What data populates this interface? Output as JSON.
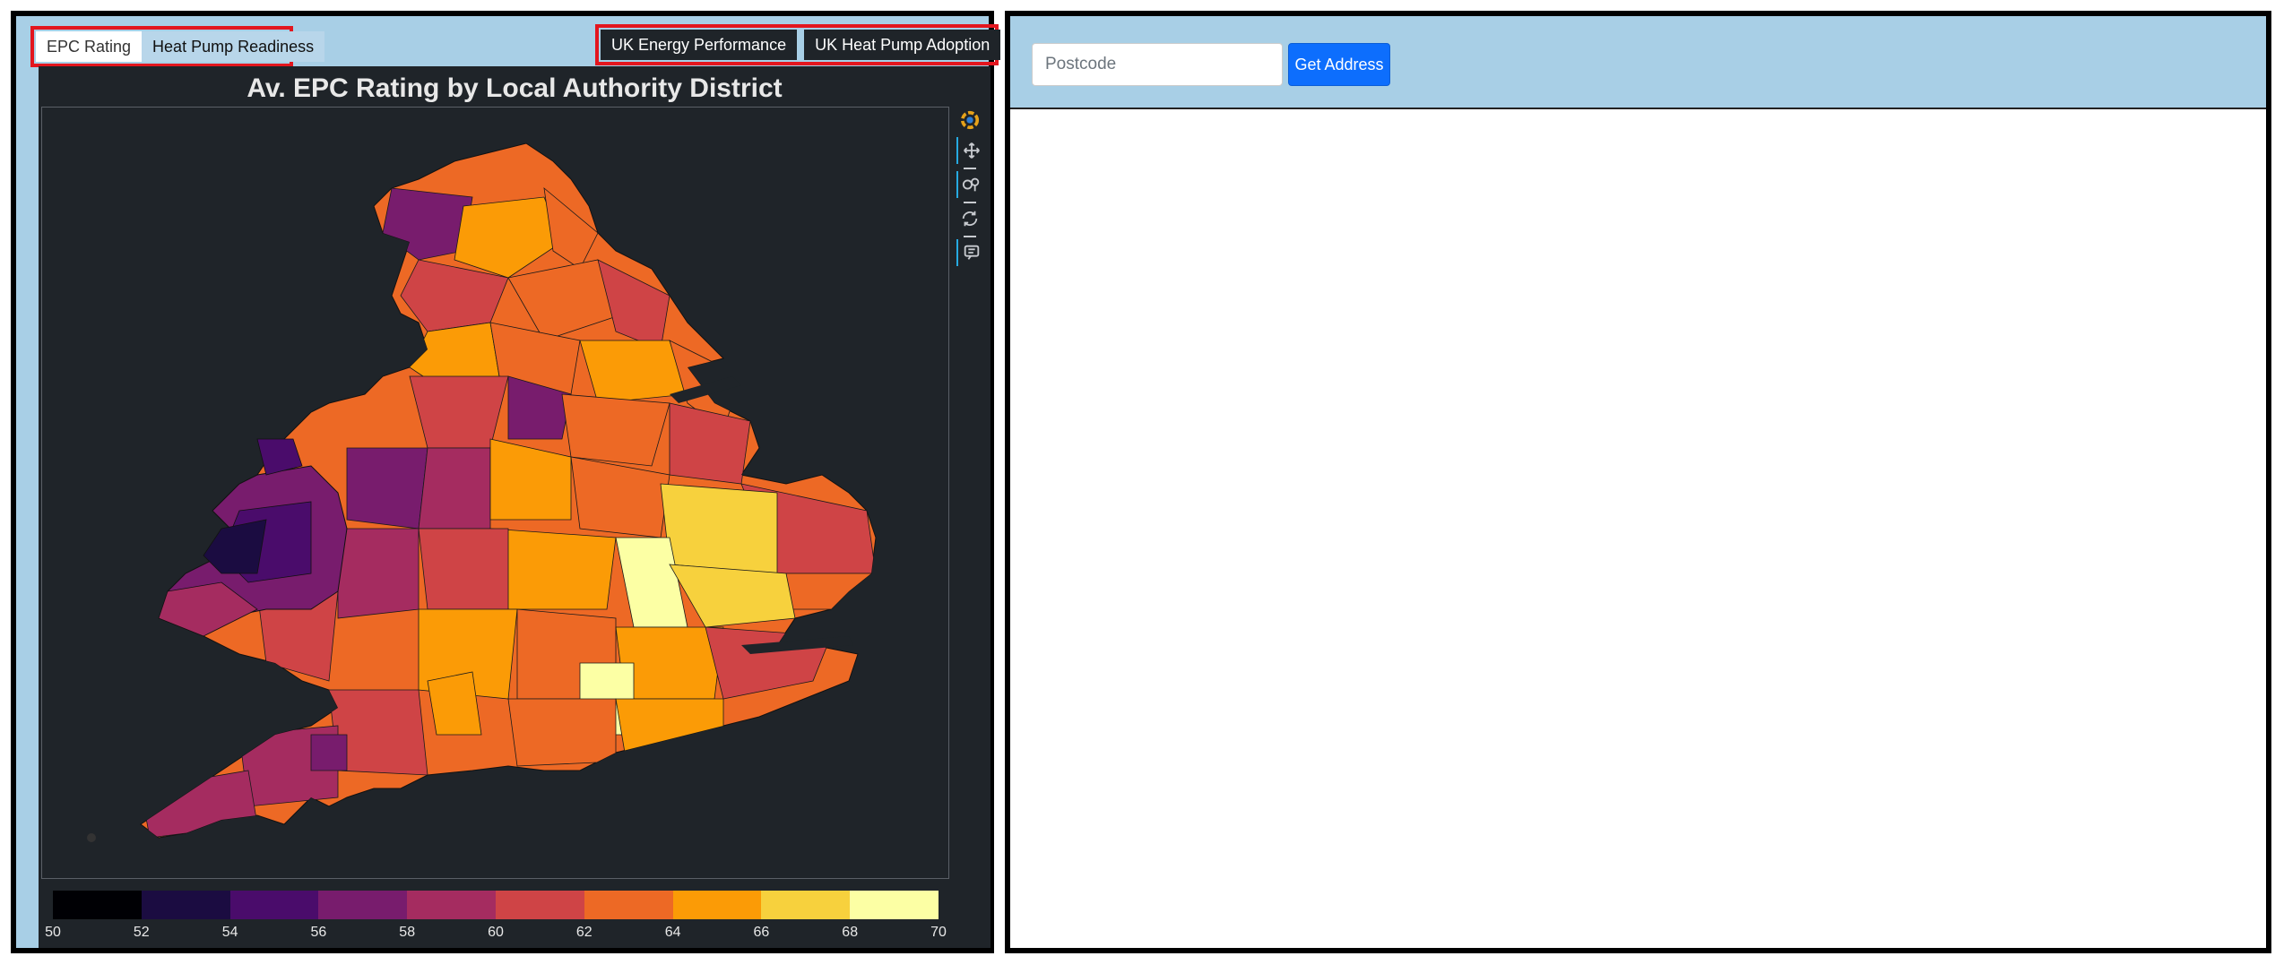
{
  "left_tabs": [
    {
      "label": "EPC Rating",
      "active": true
    },
    {
      "label": "Heat Pump Readiness",
      "active": false
    }
  ],
  "right_tabs": [
    {
      "label": "UK Energy Performance"
    },
    {
      "label": "UK Heat Pump Adoption"
    }
  ],
  "chart": {
    "title": "Av. EPC Rating by Local Authority District",
    "colorbar": {
      "colors": [
        "#000004",
        "#1b0c41",
        "#4a0c6b",
        "#781c6d",
        "#a52c60",
        "#cf4446",
        "#ed6925",
        "#fb9b06",
        "#f7d13d",
        "#fcffa4"
      ],
      "ticks": [
        "50",
        "52",
        "54",
        "56",
        "58",
        "60",
        "62",
        "64",
        "66",
        "68",
        "70"
      ],
      "min": 50,
      "max": 70
    },
    "toolbar_icons": [
      "bokeh-logo-icon",
      "pan-icon",
      "wheel-zoom-icon",
      "reset-icon",
      "hover-icon"
    ]
  },
  "chart_data": {
    "type": "heatmap",
    "title": "Av. EPC Rating by Local Authority District",
    "colorbar_range": [
      50,
      70
    ],
    "colorbar_ticks": [
      50,
      52,
      54,
      56,
      58,
      60,
      62,
      64,
      66,
      68,
      70
    ],
    "palette": "inferno"
  },
  "address_panel": {
    "postcode_placeholder": "Postcode",
    "postcode_value": "",
    "button_label": "Get Address"
  }
}
